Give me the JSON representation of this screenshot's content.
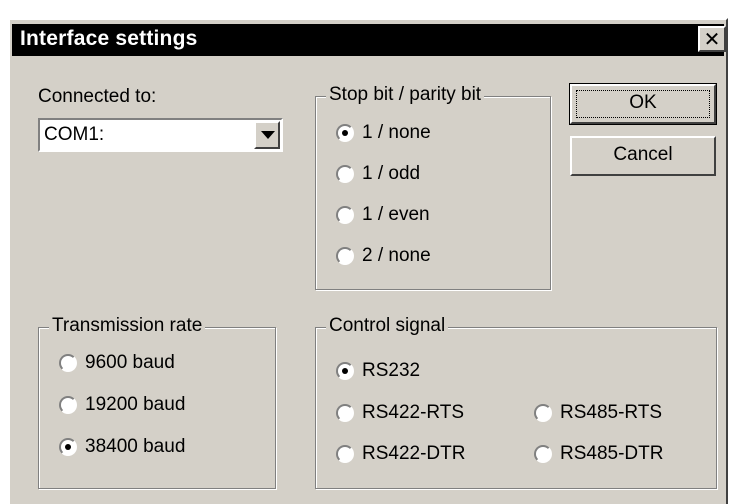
{
  "dialog": {
    "title": "Interface settings",
    "close_glyph": "✕"
  },
  "connected": {
    "label": "Connected to:",
    "value": "COM1:"
  },
  "stop_parity": {
    "legend": "Stop bit / parity bit",
    "options": [
      {
        "label": "1 / none",
        "checked": true
      },
      {
        "label": "1 / odd",
        "checked": false
      },
      {
        "label": "1 / even",
        "checked": false
      },
      {
        "label": "2 / none",
        "checked": false
      }
    ]
  },
  "buttons": {
    "ok": "OK",
    "cancel": "Cancel"
  },
  "transmission": {
    "legend": "Transmission rate",
    "options": [
      {
        "label": "9600 baud",
        "checked": false
      },
      {
        "label": "19200 baud",
        "checked": false
      },
      {
        "label": "38400 baud",
        "checked": true
      }
    ]
  },
  "control": {
    "legend": "Control signal",
    "options": [
      {
        "label": "RS232",
        "checked": true
      },
      {
        "label": "RS422-RTS",
        "checked": false
      },
      {
        "label": "RS485-RTS",
        "checked": false
      },
      {
        "label": "RS422-DTR",
        "checked": false
      },
      {
        "label": "RS485-DTR",
        "checked": false
      }
    ]
  }
}
